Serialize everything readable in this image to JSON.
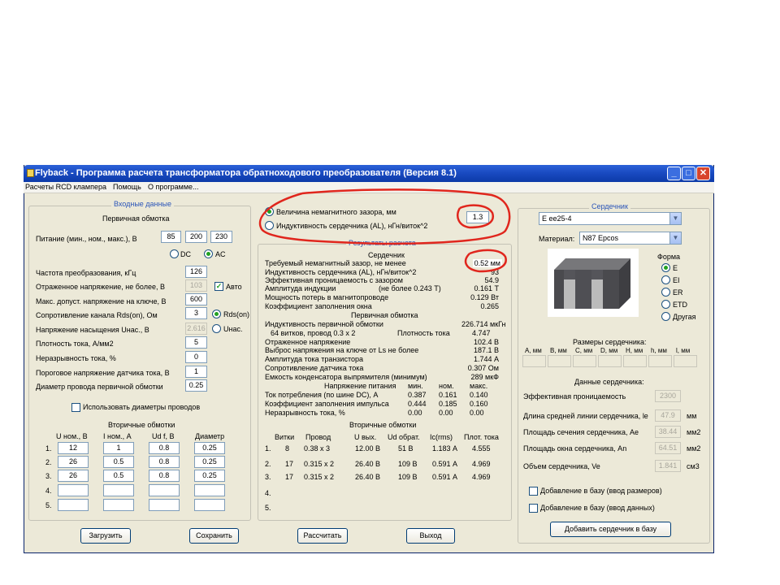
{
  "window": {
    "title": "Flyback - Программа расчета трансформатора обратноходового преобразователя (Версия 8.1)"
  },
  "menu": [
    "Расчеты RCD клампера",
    "Помощь",
    "О программе..."
  ],
  "input": {
    "section_title": "Входные данные",
    "primary_title": "Первичная обмотка",
    "supply": {
      "label": "Питание (мин., ном., макс.), В",
      "min": "85",
      "nom": "200",
      "max": "230"
    },
    "dc_label": "DC",
    "ac_label": "AC",
    "rows": [
      {
        "label": "Частота преобразования, кГц",
        "value": "126"
      },
      {
        "label": "Отраженное напряжение, не более, В",
        "value": "103"
      },
      {
        "label": "Макс. допуст. напряжение на ключе, В",
        "value": "600"
      },
      {
        "label": "Сопротивление канала Rds(on), Ом",
        "value": "3"
      },
      {
        "label": "Напряжение насыщения Uнас., В",
        "value": "2.616"
      },
      {
        "label": "Плотность тока, А/мм2",
        "value": "5"
      },
      {
        "label": "Неразрывность тока, %",
        "value": "0"
      },
      {
        "label": "Пороговое напряжение датчика тока, В",
        "value": "1"
      },
      {
        "label": "Диаметр провода первичной обмотки",
        "value": "0.25"
      }
    ],
    "auto_label": "Авто",
    "rds_label": "Rds(on)",
    "usat_label": "Uнас.",
    "use_diam_label": "Использовать диаметры проводов",
    "secondary_title": "Вторичные обмотки",
    "sec_headers": [
      "U ном., В",
      "I ном., А",
      "Ud f, В",
      "Диаметр"
    ],
    "sec_rows": [
      {
        "n": "1.",
        "u": "12",
        "i": "1",
        "ud": "0.8",
        "d": "0.25"
      },
      {
        "n": "2.",
        "u": "26",
        "i": "0.5",
        "ud": "0.8",
        "d": "0.25"
      },
      {
        "n": "3.",
        "u": "26",
        "i": "0.5",
        "ud": "0.8",
        "d": "0.25"
      },
      {
        "n": "4.",
        "u": "",
        "i": "",
        "ud": "",
        "d": ""
      },
      {
        "n": "5.",
        "u": "",
        "i": "",
        "ud": "",
        "d": ""
      }
    ]
  },
  "mode": {
    "gap_label": "Величина немагнитного зазора, мм",
    "gap_value": "1.3",
    "al_label": "Индуктивность сердечника (AL), нГн/виток^2"
  },
  "results": {
    "title": "Результаты расчета",
    "core_title": "Сердечник",
    "core_rows": [
      {
        "label": "Требуемый немагнитный зазор, не менее",
        "value": "0.52 мм"
      },
      {
        "label": "Индуктивность сердечника (AL), нГн/виток^2",
        "value": "93"
      },
      {
        "label": "Эффективная проницаемость с зазором",
        "value": "54.9"
      },
      {
        "label": "Амплитуда индукции",
        "note": "(не более 0.243 Т)",
        "value": "0.161 Т"
      },
      {
        "label": "Мощность потерь в магнитопроводе",
        "value": "0.129 Вт"
      },
      {
        "label": "Коэффициент заполнения окна",
        "value": "0.265"
      }
    ],
    "primary_title": "Первичная обмотка",
    "primary_inductance_label": "Индуктивность первичной обмотки",
    "primary_inductance_value": "226.714 мкГн",
    "turns_text": "64 витков, провод 0.3 x 2",
    "density_label": "Плотность тока",
    "density_value": "4.747",
    "primary_rows": [
      {
        "label": "Отраженное напряжение",
        "value": "102.4 В"
      },
      {
        "label": "Выброс напряжения на ключе от Ls не более",
        "value": "187.1 В"
      },
      {
        "label": "Амплитуда тока транзистора",
        "value": "1.744 А"
      },
      {
        "label": "Сопротивление датчика тока",
        "value": "0.307 Ом"
      },
      {
        "label": "Емкость конденсатора выпрямителя (минимум)",
        "value": "289 мкФ"
      }
    ],
    "supply_header": {
      "label": "Напряжение питания",
      "min": "мин.",
      "nom": "ном.",
      "max": "макс."
    },
    "supply_rows": [
      {
        "label": "Ток потребления (по шине DC), А",
        "min": "0.387",
        "nom": "0.161",
        "max": "0.140"
      },
      {
        "label": "Коэффициент заполнения импульса",
        "min": "0.444",
        "nom": "0.185",
        "max": "0.160"
      },
      {
        "label": "Неразрывность тока, %",
        "min": "0.00",
        "nom": "0.00",
        "max": "0.00"
      }
    ],
    "secondary_title": "Вторичные обмотки",
    "sec_headers": [
      "Витки",
      "Провод",
      "U вых.",
      "Ud обрат.",
      "Ic(rms)",
      "Плот. тока"
    ],
    "sec_rows": [
      {
        "n": "1.",
        "turns": "8",
        "wire": "0.38 x 3",
        "uout": "12.00 В",
        "ud": "51 В",
        "ic": "1.183 А",
        "j": "4.555"
      },
      {
        "n": "2.",
        "turns": "17",
        "wire": "0.315 x 2",
        "uout": "26.40 В",
        "ud": "109 В",
        "ic": "0.591 А",
        "j": "4.969"
      },
      {
        "n": "3.",
        "turns": "17",
        "wire": "0.315 x 2",
        "uout": "26.40 В",
        "ud": "109 В",
        "ic": "0.591 А",
        "j": "4.969"
      },
      {
        "n": "4.",
        "turns": "",
        "wire": "",
        "uout": "",
        "ud": "",
        "ic": "",
        "j": ""
      },
      {
        "n": "5.",
        "turns": "",
        "wire": "",
        "uout": "",
        "ud": "",
        "ic": "",
        "j": ""
      }
    ]
  },
  "core": {
    "title": "Сердечник",
    "core_value": "E ee25-4",
    "material_label": "Материал:",
    "material_value": "N87 Epcos",
    "shape_label": "Форма",
    "shapes": [
      "E",
      "EI",
      "ER",
      "ETD",
      "Другая"
    ],
    "dims_title": "Размеры сердечника:",
    "dims": [
      "A, мм",
      "B, мм",
      "C, мм",
      "D, мм",
      "H, мм",
      "h, мм",
      "l, мм"
    ],
    "data_title": "Данные сердечника:",
    "data_rows": [
      {
        "label": "Эффективная проницаемость",
        "value": "2300",
        "unit": ""
      },
      {
        "label": "Длина средней линии сердечника, le",
        "value": "47.9",
        "unit": "мм"
      },
      {
        "label": "Площадь сечения сердечника, Ae",
        "value": "38.44",
        "unit": "мм2"
      },
      {
        "label": "Площадь окна сердечника, An",
        "value": "64.51",
        "unit": "мм2"
      },
      {
        "label": "Объем сердечника, Ve",
        "value": "1.841",
        "unit": "см3"
      }
    ],
    "add_dims_label": "Добавление в базу (ввод размеров)",
    "add_data_label": "Добавление в базу (ввод данных)",
    "add_button": "Добавить сердечник в базу"
  },
  "buttons": {
    "load": "Загрузить",
    "save": "Сохранить",
    "calc": "Рассчитать",
    "exit": "Выход"
  },
  "annotation_color": "#e0261d"
}
